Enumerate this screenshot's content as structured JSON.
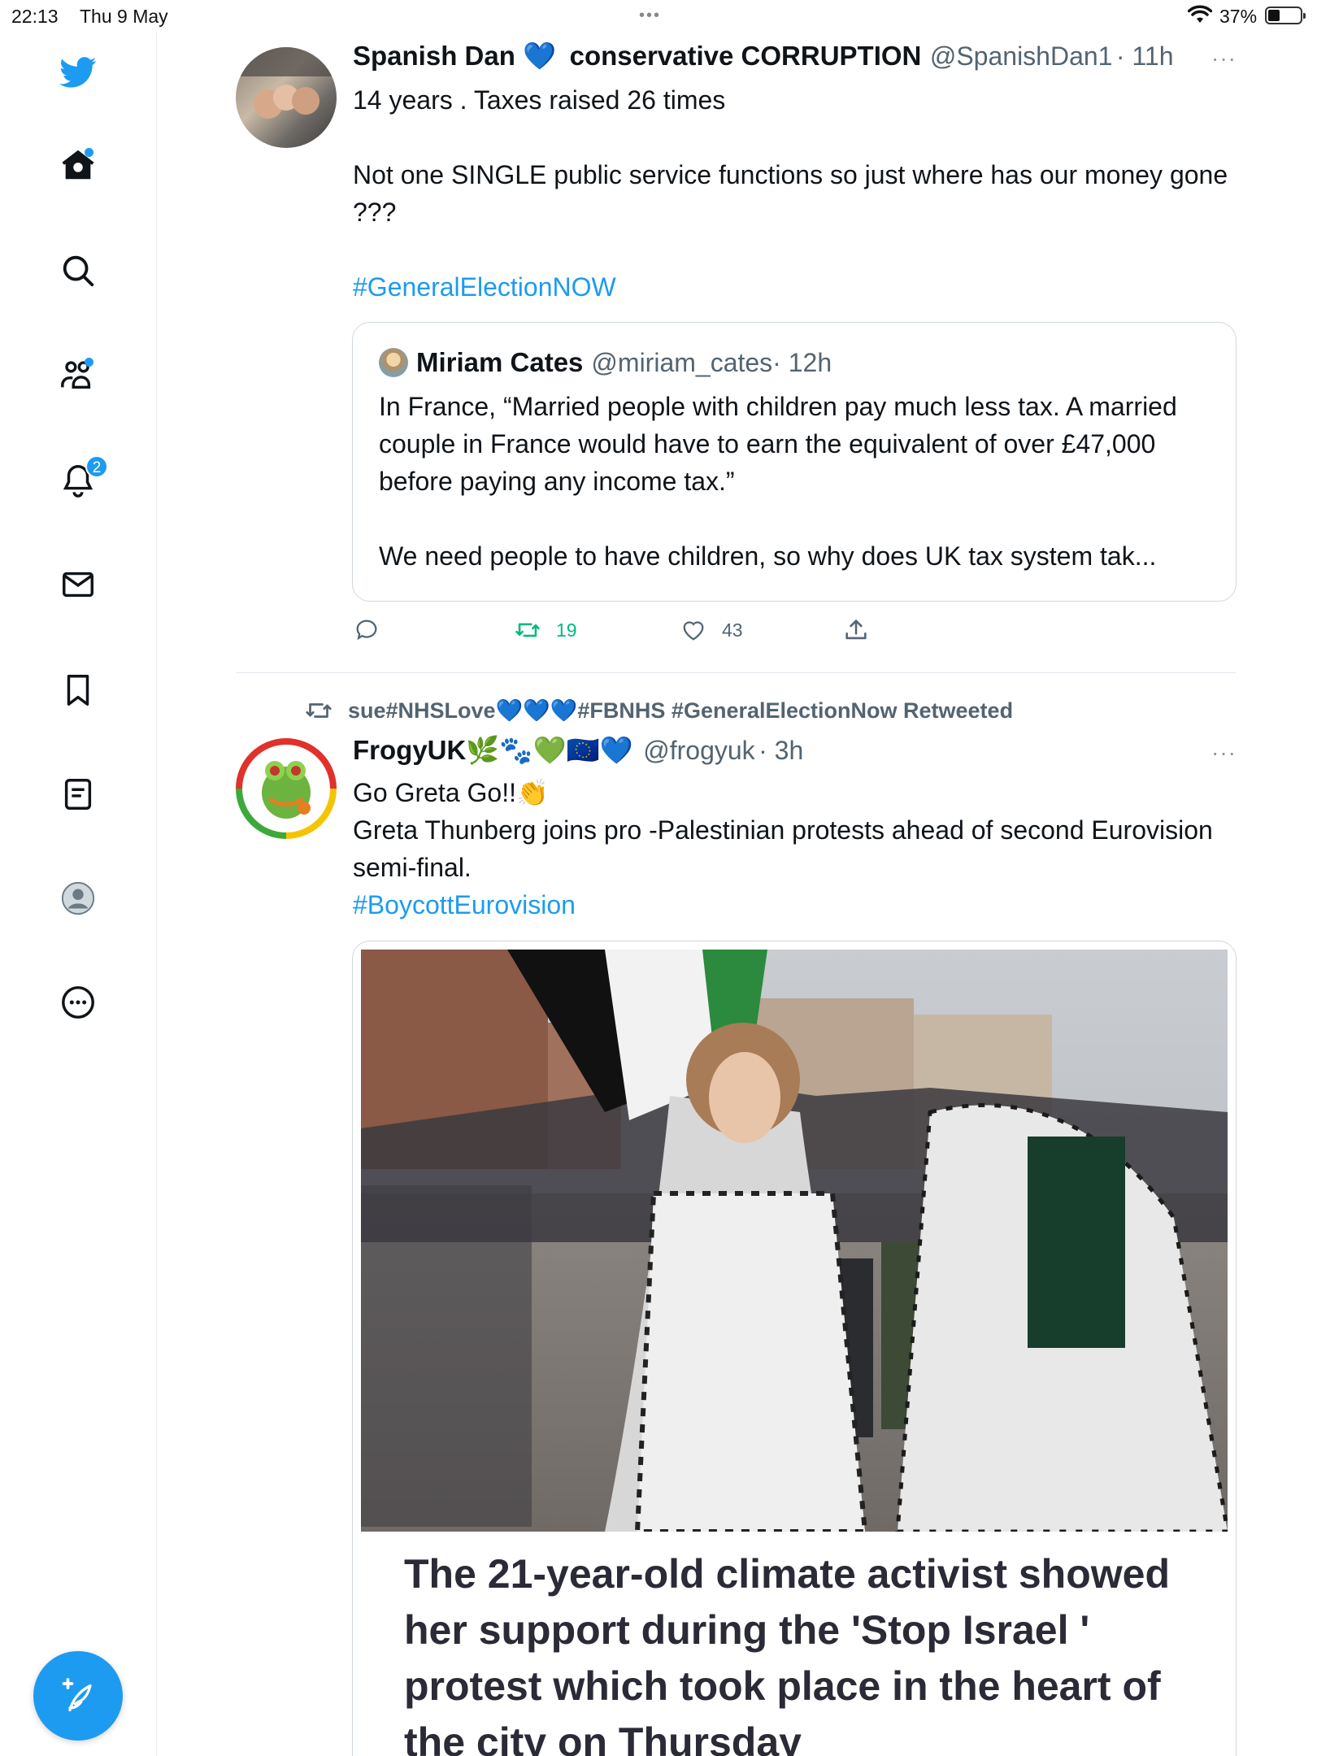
{
  "status_bar": {
    "time": "22:13",
    "date": "Thu 9 May",
    "battery": "37%",
    "battery_level": 0.37
  },
  "sidebar": {
    "items": [
      {
        "name": "home",
        "icon": "home-icon",
        "has_dot": true
      },
      {
        "name": "explore",
        "icon": "search-icon"
      },
      {
        "name": "communities",
        "icon": "communities-icon",
        "has_dot": true
      },
      {
        "name": "notifications",
        "icon": "bell-icon",
        "badge": "2"
      },
      {
        "name": "messages",
        "icon": "mail-icon"
      },
      {
        "name": "bookmarks",
        "icon": "bookmark-icon"
      },
      {
        "name": "lists",
        "icon": "lists-icon"
      },
      {
        "name": "profile",
        "icon": "profile-icon"
      },
      {
        "name": "more",
        "icon": "more-circle-icon"
      }
    ],
    "compose_icon": "compose-icon"
  },
  "tweet1": {
    "name": "Spanish Dan 💙",
    "name_suffix": "conservative CORRUPTION",
    "handle": "@SpanishDan1",
    "time": "· 11h",
    "text_line1": "14 years . Taxes raised 26 times",
    "text_line2": "Not one SINGLE public service functions so just where has our money gone ???",
    "hashtag": "#GeneralElectionNOW",
    "quote": {
      "name": "Miriam Cates",
      "handle": "@miriam_cates",
      "time": "· 12h",
      "text1": "In France, “Married people with children pay much less tax. A married couple in France would have to earn the equivalent of over £47,000 before paying any income tax.”",
      "text2": "We need people to have children, so why does UK tax system tak..."
    },
    "actions": {
      "retweets": "19",
      "likes": "43"
    }
  },
  "tweet2": {
    "retweeted_by": "sue#NHSLove💙💙💙#FBNHS #GeneralElectionNow Retweeted",
    "name": "FrogyUK🌿🐾💚🇪🇺💙",
    "handle": "@frogyuk",
    "time": "· 3h",
    "text_line1": "Go Greta Go!!👏",
    "text_line2": "Greta Thunberg joins pro -Palestinian protests ahead of second Eurovision semi-final.",
    "hashtag": "#BoycottEurovision",
    "card_headline": "The 21-year-old climate activist showed her support during the 'Stop Israel ' protest which took place in the heart of the city on Thursday"
  },
  "colors": {
    "accent": "#1d9bf0",
    "retweet_green": "#00ba7c",
    "text": "#0f1419",
    "secondary": "#536471"
  }
}
